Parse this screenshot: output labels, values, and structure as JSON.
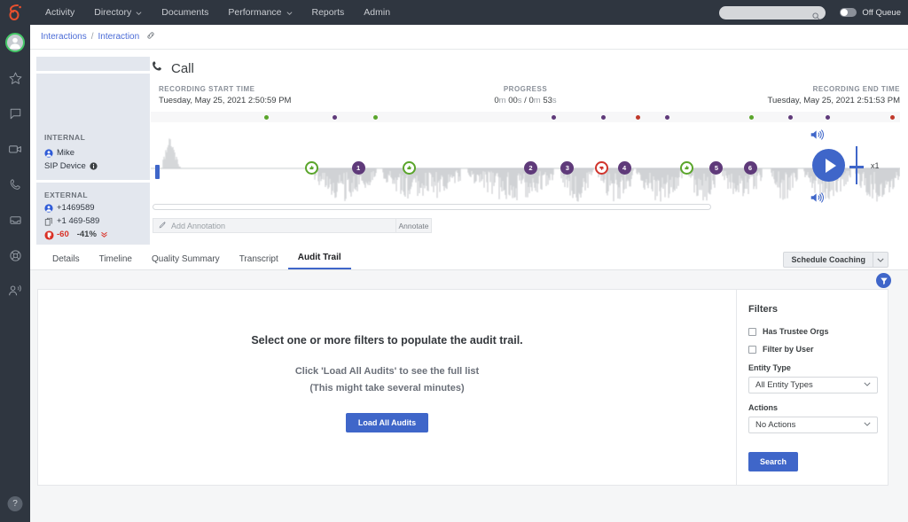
{
  "topnav": {
    "brand_icon": "genesys-logo-icon",
    "items": [
      {
        "label": "Activity",
        "caret": false
      },
      {
        "label": "Directory",
        "caret": true
      },
      {
        "label": "Documents",
        "caret": false
      },
      {
        "label": "Performance",
        "caret": true
      },
      {
        "label": "Reports",
        "caret": false
      },
      {
        "label": "Admin",
        "caret": false
      }
    ],
    "search_placeholder": "",
    "queue_status": "Off Queue"
  },
  "rail": {
    "items": [
      {
        "icon": "avatar-icon",
        "name": "profile-avatar"
      },
      {
        "icon": "star-icon",
        "name": "favorites"
      },
      {
        "icon": "chat-bubble-icon",
        "name": "chat"
      },
      {
        "icon": "video-camera-icon",
        "name": "video"
      },
      {
        "icon": "phone-icon",
        "name": "calls"
      },
      {
        "icon": "inbox-icon",
        "name": "inbox"
      },
      {
        "icon": "lifering-icon",
        "name": "support"
      },
      {
        "icon": "user-voice-icon",
        "name": "agent-assist"
      }
    ],
    "help_glyph": "?"
  },
  "breadcrumb": {
    "root": "Interactions",
    "separator": "/",
    "current": "Interaction",
    "link_icon": "link-icon"
  },
  "participants": {
    "internal": {
      "heading": "INTERNAL",
      "name": "Mike",
      "device": "SIP Device",
      "info_icon": "info-icon",
      "person_icon": "person-icon"
    },
    "external": {
      "heading": "EXTERNAL",
      "number": "+1469589",
      "dialed": "+1 469-589",
      "person_icon": "person-icon",
      "phone_copy_icon": "copy-icon",
      "sentiment_icon": "thumbs-down-icon",
      "sentiment_score": "-60",
      "sentiment_pct": "-41%",
      "trend_icon": "double-chevron-down-icon"
    }
  },
  "call_header": {
    "icon": "phone-icon",
    "title": "Call"
  },
  "player": {
    "start_label": "RECORDING START TIME",
    "start_value": "Tuesday, May 25, 2021 2:50:59 PM",
    "progress_label": "PROGRESS",
    "progress_current_min": "0",
    "progress_current_min_unit": "m ",
    "progress_current_sec": "00",
    "progress_current_sec_unit": "s",
    "progress_sep": " / ",
    "progress_total_min": "0",
    "progress_total_min_unit": "m ",
    "progress_total_sec": "53",
    "progress_total_sec_unit": "s",
    "progress_value": "0m 00s / 0m 53s",
    "end_label": "RECORDING END TIME",
    "end_value": "Tuesday, May 25, 2021 2:51:53 PM",
    "event_markers": [
      {
        "x": 0.155,
        "color": "#5aa52b"
      },
      {
        "x": 0.245,
        "color": "#5f3a7a"
      },
      {
        "x": 0.3,
        "color": "#5aa52b"
      },
      {
        "x": 0.538,
        "color": "#5f3a7a"
      },
      {
        "x": 0.604,
        "color": "#5f3a7a"
      },
      {
        "x": 0.65,
        "color": "#c0392b"
      },
      {
        "x": 0.689,
        "color": "#5f3a7a"
      },
      {
        "x": 0.802,
        "color": "#5aa52b"
      },
      {
        "x": 0.854,
        "color": "#5f3a7a"
      },
      {
        "x": 0.903,
        "color": "#5f3a7a"
      },
      {
        "x": 0.99,
        "color": "#c0392b"
      }
    ],
    "pins": [
      {
        "x": 0.215,
        "type": "up",
        "label": ""
      },
      {
        "x": 0.277,
        "type": "num",
        "label": "1"
      },
      {
        "x": 0.345,
        "type": "up",
        "label": ""
      },
      {
        "x": 0.507,
        "type": "num",
        "label": "2"
      },
      {
        "x": 0.556,
        "type": "num",
        "label": "3"
      },
      {
        "x": 0.602,
        "type": "down",
        "label": ""
      },
      {
        "x": 0.632,
        "type": "num",
        "label": "4"
      },
      {
        "x": 0.715,
        "type": "up",
        "label": ""
      },
      {
        "x": 0.755,
        "type": "num",
        "label": "5"
      },
      {
        "x": 0.8,
        "type": "num",
        "label": "6"
      },
      {
        "x": 0.895,
        "type": "down",
        "label": ""
      }
    ],
    "annotation_placeholder": "Add Annotation",
    "annotation_value": "",
    "annotate_button": "Annotate",
    "annotation_icon": "pencil-icon",
    "speaker_up_icon": "speaker-icon",
    "speaker_down_icon": "speaker-icon",
    "play_icon": "play-icon",
    "speed_label": "x1"
  },
  "tabs": {
    "items": [
      {
        "label": "Details",
        "active": false
      },
      {
        "label": "Timeline",
        "active": false
      },
      {
        "label": "Quality Summary",
        "active": false
      },
      {
        "label": "Transcript",
        "active": false
      },
      {
        "label": "Audit Trail",
        "active": true
      }
    ],
    "coaching_button": "Schedule Coaching",
    "coaching_caret_icon": "chevron-down-icon"
  },
  "audit": {
    "filter_toggle_icon": "funnel-icon",
    "message_title": "Select one or more filters to populate the audit trail.",
    "message_line1": "Click 'Load All Audits' to see the full list",
    "message_line2": "(This might take several minutes)",
    "load_button": "Load All Audits"
  },
  "filters": {
    "title": "Filters",
    "checkboxes": [
      {
        "label": "Has Trustee Orgs",
        "checked": false
      },
      {
        "label": "Filter by User",
        "checked": false
      }
    ],
    "entity_type_label": "Entity Type",
    "entity_type_value": "All Entity Types",
    "actions_label": "Actions",
    "actions_value": "No Actions",
    "search_button": "Search"
  },
  "colors": {
    "nav_bg": "#2f3640",
    "accent_blue": "#3f66c9",
    "link_blue": "#4a6bd6",
    "green": "#5aa52b",
    "purple": "#5f3a7a",
    "red": "#c0392b",
    "negative_red": "#d93025",
    "panel_bg": "#e3e7ee",
    "content_bg": "#f5f6f7"
  }
}
